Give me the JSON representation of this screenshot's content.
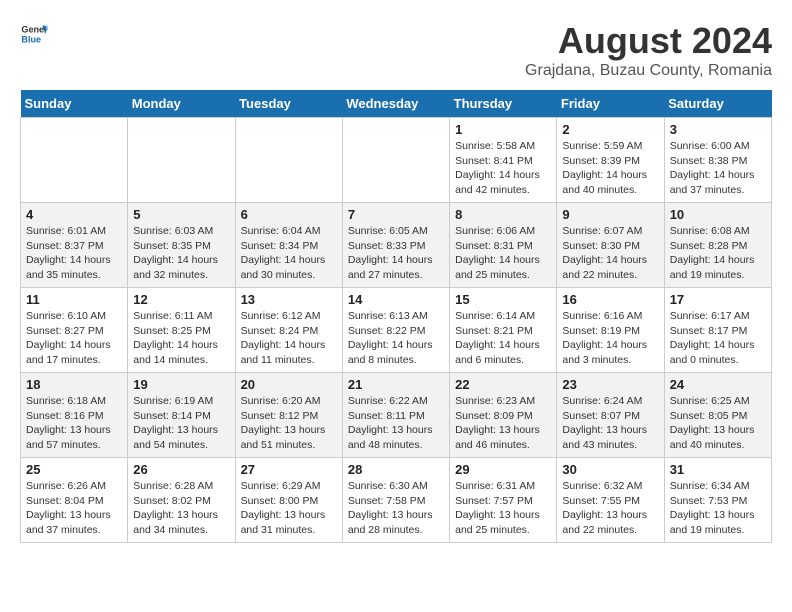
{
  "header": {
    "logo_general": "General",
    "logo_blue": "Blue",
    "main_title": "August 2024",
    "subtitle": "Grajdana, Buzau County, Romania"
  },
  "weekdays": [
    "Sunday",
    "Monday",
    "Tuesday",
    "Wednesday",
    "Thursday",
    "Friday",
    "Saturday"
  ],
  "weeks": [
    [
      {
        "day": "",
        "detail": ""
      },
      {
        "day": "",
        "detail": ""
      },
      {
        "day": "",
        "detail": ""
      },
      {
        "day": "",
        "detail": ""
      },
      {
        "day": "1",
        "detail": "Sunrise: 5:58 AM\nSunset: 8:41 PM\nDaylight: 14 hours and 42 minutes."
      },
      {
        "day": "2",
        "detail": "Sunrise: 5:59 AM\nSunset: 8:39 PM\nDaylight: 14 hours and 40 minutes."
      },
      {
        "day": "3",
        "detail": "Sunrise: 6:00 AM\nSunset: 8:38 PM\nDaylight: 14 hours and 37 minutes."
      }
    ],
    [
      {
        "day": "4",
        "detail": "Sunrise: 6:01 AM\nSunset: 8:37 PM\nDaylight: 14 hours and 35 minutes."
      },
      {
        "day": "5",
        "detail": "Sunrise: 6:03 AM\nSunset: 8:35 PM\nDaylight: 14 hours and 32 minutes."
      },
      {
        "day": "6",
        "detail": "Sunrise: 6:04 AM\nSunset: 8:34 PM\nDaylight: 14 hours and 30 minutes."
      },
      {
        "day": "7",
        "detail": "Sunrise: 6:05 AM\nSunset: 8:33 PM\nDaylight: 14 hours and 27 minutes."
      },
      {
        "day": "8",
        "detail": "Sunrise: 6:06 AM\nSunset: 8:31 PM\nDaylight: 14 hours and 25 minutes."
      },
      {
        "day": "9",
        "detail": "Sunrise: 6:07 AM\nSunset: 8:30 PM\nDaylight: 14 hours and 22 minutes."
      },
      {
        "day": "10",
        "detail": "Sunrise: 6:08 AM\nSunset: 8:28 PM\nDaylight: 14 hours and 19 minutes."
      }
    ],
    [
      {
        "day": "11",
        "detail": "Sunrise: 6:10 AM\nSunset: 8:27 PM\nDaylight: 14 hours and 17 minutes."
      },
      {
        "day": "12",
        "detail": "Sunrise: 6:11 AM\nSunset: 8:25 PM\nDaylight: 14 hours and 14 minutes."
      },
      {
        "day": "13",
        "detail": "Sunrise: 6:12 AM\nSunset: 8:24 PM\nDaylight: 14 hours and 11 minutes."
      },
      {
        "day": "14",
        "detail": "Sunrise: 6:13 AM\nSunset: 8:22 PM\nDaylight: 14 hours and 8 minutes."
      },
      {
        "day": "15",
        "detail": "Sunrise: 6:14 AM\nSunset: 8:21 PM\nDaylight: 14 hours and 6 minutes."
      },
      {
        "day": "16",
        "detail": "Sunrise: 6:16 AM\nSunset: 8:19 PM\nDaylight: 14 hours and 3 minutes."
      },
      {
        "day": "17",
        "detail": "Sunrise: 6:17 AM\nSunset: 8:17 PM\nDaylight: 14 hours and 0 minutes."
      }
    ],
    [
      {
        "day": "18",
        "detail": "Sunrise: 6:18 AM\nSunset: 8:16 PM\nDaylight: 13 hours and 57 minutes."
      },
      {
        "day": "19",
        "detail": "Sunrise: 6:19 AM\nSunset: 8:14 PM\nDaylight: 13 hours and 54 minutes."
      },
      {
        "day": "20",
        "detail": "Sunrise: 6:20 AM\nSunset: 8:12 PM\nDaylight: 13 hours and 51 minutes."
      },
      {
        "day": "21",
        "detail": "Sunrise: 6:22 AM\nSunset: 8:11 PM\nDaylight: 13 hours and 48 minutes."
      },
      {
        "day": "22",
        "detail": "Sunrise: 6:23 AM\nSunset: 8:09 PM\nDaylight: 13 hours and 46 minutes."
      },
      {
        "day": "23",
        "detail": "Sunrise: 6:24 AM\nSunset: 8:07 PM\nDaylight: 13 hours and 43 minutes."
      },
      {
        "day": "24",
        "detail": "Sunrise: 6:25 AM\nSunset: 8:05 PM\nDaylight: 13 hours and 40 minutes."
      }
    ],
    [
      {
        "day": "25",
        "detail": "Sunrise: 6:26 AM\nSunset: 8:04 PM\nDaylight: 13 hours and 37 minutes."
      },
      {
        "day": "26",
        "detail": "Sunrise: 6:28 AM\nSunset: 8:02 PM\nDaylight: 13 hours and 34 minutes."
      },
      {
        "day": "27",
        "detail": "Sunrise: 6:29 AM\nSunset: 8:00 PM\nDaylight: 13 hours and 31 minutes."
      },
      {
        "day": "28",
        "detail": "Sunrise: 6:30 AM\nSunset: 7:58 PM\nDaylight: 13 hours and 28 minutes."
      },
      {
        "day": "29",
        "detail": "Sunrise: 6:31 AM\nSunset: 7:57 PM\nDaylight: 13 hours and 25 minutes."
      },
      {
        "day": "30",
        "detail": "Sunrise: 6:32 AM\nSunset: 7:55 PM\nDaylight: 13 hours and 22 minutes."
      },
      {
        "day": "31",
        "detail": "Sunrise: 6:34 AM\nSunset: 7:53 PM\nDaylight: 13 hours and 19 minutes."
      }
    ]
  ]
}
